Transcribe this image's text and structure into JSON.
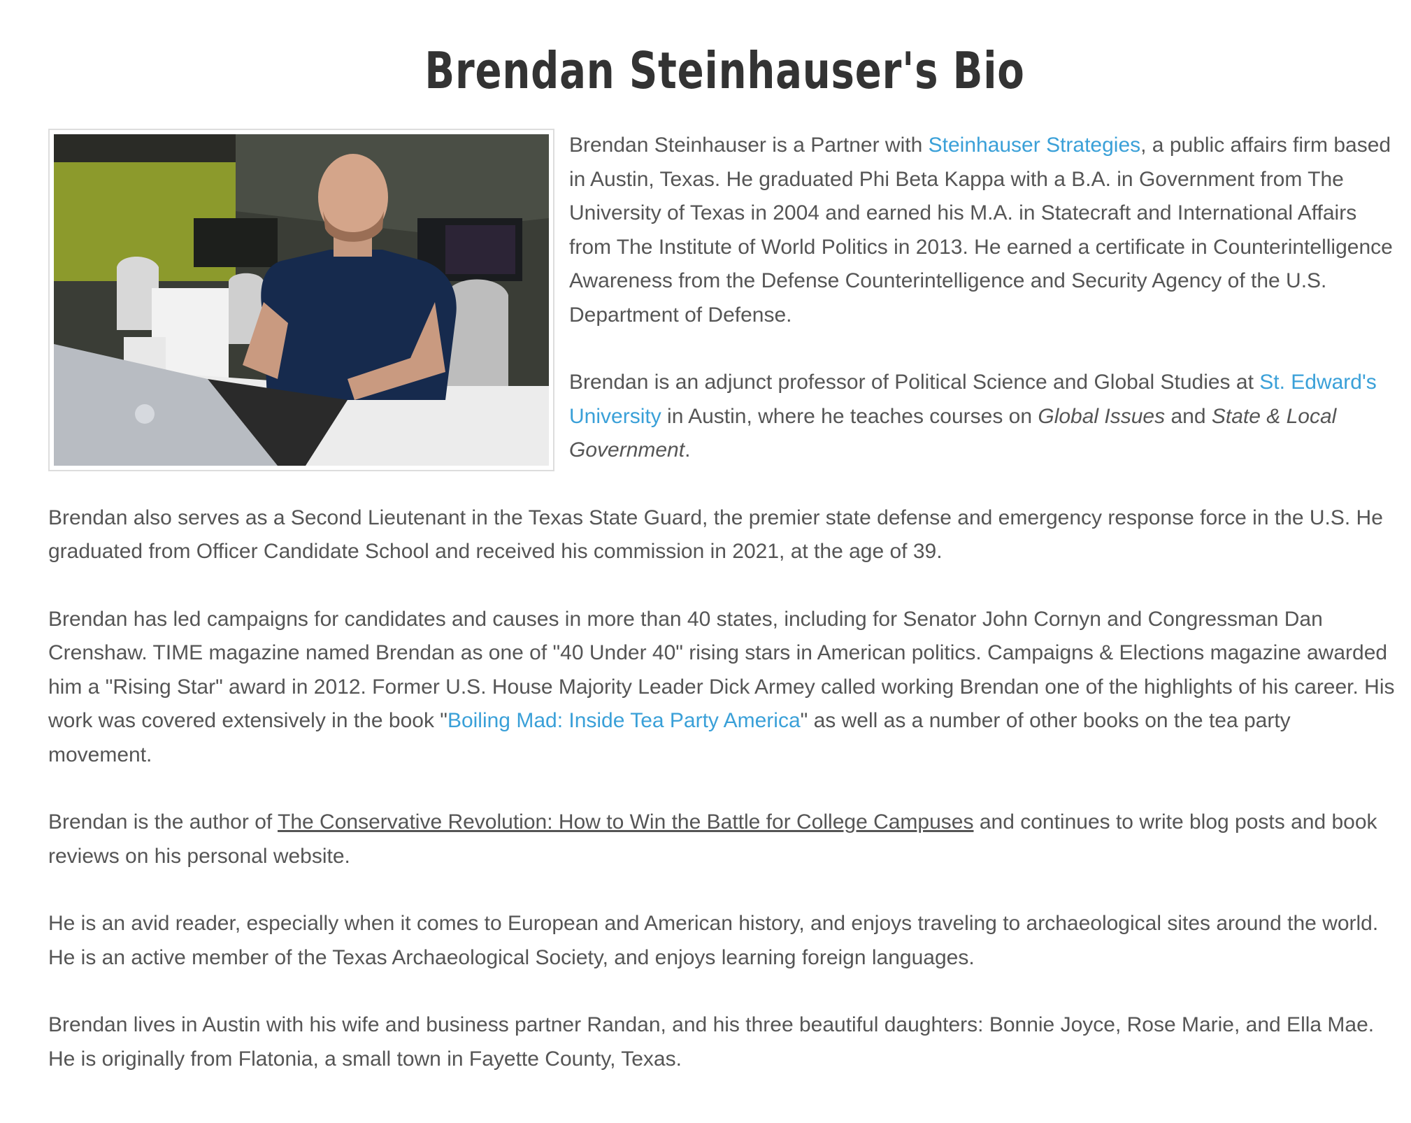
{
  "page": {
    "title": "Brendan Steinhauser's Bio"
  },
  "photo": {
    "alt": "Brendan Steinhauser seated at a desk with a laptop in an office"
  },
  "bio": {
    "p1": {
      "t1": "Brendan Steinhauser is a Partner with ",
      "link": "Steinhauser Strategies",
      "t2": ", a public affairs firm based in Austin, Texas. He graduated Phi Beta Kappa with a B.A. in Government from The University of Texas in 2004 and earned his M.A. in Statecraft and International Affairs from The Institute of World Politics in 2013. He earned a certificate in Counterintelligence Awareness from the Defense Counterintelligence and Security Agency of the U.S. Department of Defense."
    },
    "p2": {
      "t1": "Brendan is an adjunct professor of Political Science and Global Studies at ",
      "link": "St. Edward's University",
      "t2": " in Austin, where he teaches courses on ",
      "em1": "Global Issues",
      "t3": " and ",
      "em2": "State & Local Government",
      "t4": "."
    },
    "p3": "Brendan also serves as a Second Lieutenant in the Texas State Guard, the premier state defense and emergency response force in the U.S. He graduated from Officer Candidate School and received his commission in 2021, at the age of 39.",
    "p4": {
      "t1": "Brendan has led campaigns for candidates and causes in more than 40 states, including for Senator John Cornyn and Congressman Dan Crenshaw. TIME magazine named Brendan as one of \"40 Under 40\" rising stars in American politics. Campaigns & Elections magazine awarded him a \"Rising Star\" award in 2012. Former U.S. House Majority Leader Dick Armey called working Brendan one of the highlights of his career. His work was covered extensively in the book \"",
      "link": "Boiling Mad: Inside Tea Party America",
      "t2": "\" as well as a number of other books on the tea party movement."
    },
    "p5": {
      "t1": "Brendan is the author of ",
      "link": "The Conservative Revolution: How to Win the Battle for College Campuses",
      "t2": " and continues to write blog posts and book reviews on his personal website."
    },
    "p6": "He is an avid reader, especially when it comes to European and American history, and enjoys traveling to archaeological sites around the world. He is an active member of the Texas Archaeological Society, and enjoys learning foreign languages.",
    "p7": "Brendan lives in Austin with his wife and business partner Randan, and his three beautiful daughters: Bonnie Joyce, Rose Marie, and Ella Mae. He is originally from Flatonia, a small town in Fayette County, Texas."
  },
  "colors": {
    "link": "#3aa0d8",
    "text": "#555555",
    "title": "#333333"
  }
}
